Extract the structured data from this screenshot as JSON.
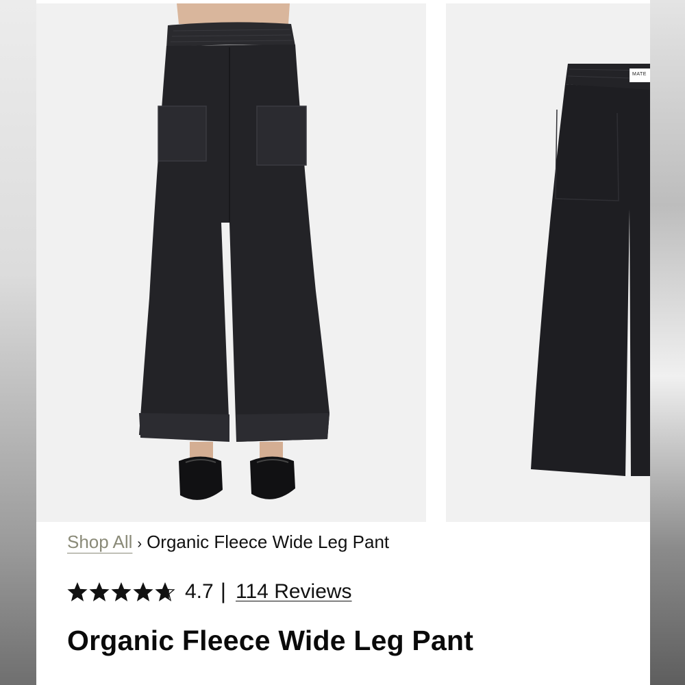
{
  "gallery": {
    "images": [
      {
        "alt": "Model wearing black wide leg fleece pant"
      },
      {
        "alt": "Black wide leg fleece pant flat lay"
      }
    ],
    "tag_label": "MATE"
  },
  "breadcrumb": {
    "root_label": "Shop All",
    "separator": "›",
    "current_label": "Organic Fleece Wide Leg Pant"
  },
  "rating": {
    "value": "4.7",
    "stars_filled": 4.7,
    "stars_total": 5,
    "divider": "|",
    "reviews_label": "114 Reviews"
  },
  "product": {
    "title": "Organic Fleece Wide Leg Pant"
  },
  "colors": {
    "fabric": "#1f1f22",
    "photo_bg": "#f1f1f1",
    "breadcrumb_link": "#8a8a78",
    "text": "#111111"
  }
}
